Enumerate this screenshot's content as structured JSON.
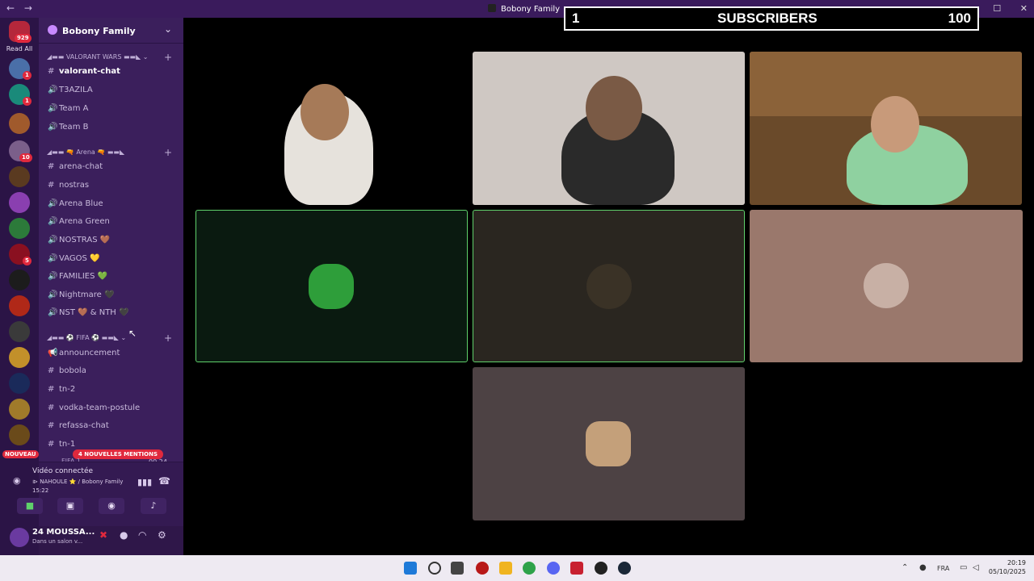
{
  "window": {
    "title": "Bobony Family",
    "back": "←",
    "forward": "→",
    "controls": [
      "—",
      "☐",
      "✕"
    ]
  },
  "servers": {
    "top_badge": "929",
    "read_all": "Read All",
    "badges": [
      "1",
      "1",
      "10",
      "5"
    ],
    "nouveau": "NOUVEAU"
  },
  "sidebar": {
    "server_name": "Bobony Family",
    "categories": [
      {
        "label": "◢▬▬ VALORANT WARS ▬▬◣  ⌄"
      },
      {
        "label": "◢▬▬ 🔫 Arena 🔫 ▬▬◣"
      },
      {
        "label": "◢▬▬ ⚽ FIFA ⚽ ▬▬◣ ⌄"
      }
    ],
    "channels": [
      {
        "name": "valorant-chat",
        "type": "#"
      },
      {
        "name": "T3AZILA",
        "type": "🔊"
      },
      {
        "name": "Team A",
        "type": "🔊"
      },
      {
        "name": "Team B",
        "type": "🔊"
      },
      {
        "name": "arena-chat",
        "type": "#"
      },
      {
        "name": "nostras",
        "type": "#"
      },
      {
        "name": "Arena Blue",
        "type": "🔊"
      },
      {
        "name": "Arena Green",
        "type": "🔊"
      },
      {
        "name": "NOSTRAS 🤎",
        "type": "🔊"
      },
      {
        "name": "VAGOS 💛",
        "type": "🔊"
      },
      {
        "name": "FAMILIES 💚",
        "type": "🔊"
      },
      {
        "name": "Nightmare 🖤",
        "type": "🔊"
      },
      {
        "name": "NST 🤎 & NTH 🖤",
        "type": "🔊"
      },
      {
        "name": "announcement",
        "type": "📢"
      },
      {
        "name": "bobola",
        "type": "#"
      },
      {
        "name": "tn-2",
        "type": "#"
      },
      {
        "name": "vodka-team-postule",
        "type": "#"
      },
      {
        "name": "refassa-chat",
        "type": "#"
      },
      {
        "name": "tn-1",
        "type": "#"
      }
    ],
    "mentions": "4 NOUVELLES MENTIONS",
    "partial_channel": "FIFA 1",
    "partial_count": "00  24"
  },
  "voice": {
    "status": "Vidéo connectée",
    "location": "⧐ NAHOULE ⭐ / Bobony Family",
    "time": "15:22"
  },
  "user": {
    "name": "24 MOUSSA...",
    "status": "Dans un salon v..."
  },
  "overlay": {
    "left": "1",
    "center": "SUBSCRIBERS",
    "right": "100"
  },
  "taskbar": {
    "lang": "FRA",
    "time": "20:19",
    "date": "05/10/2025"
  },
  "colors": {
    "accent": "#3b1f5c",
    "speaking": "#5fd16b",
    "badge": "#e0293d"
  }
}
